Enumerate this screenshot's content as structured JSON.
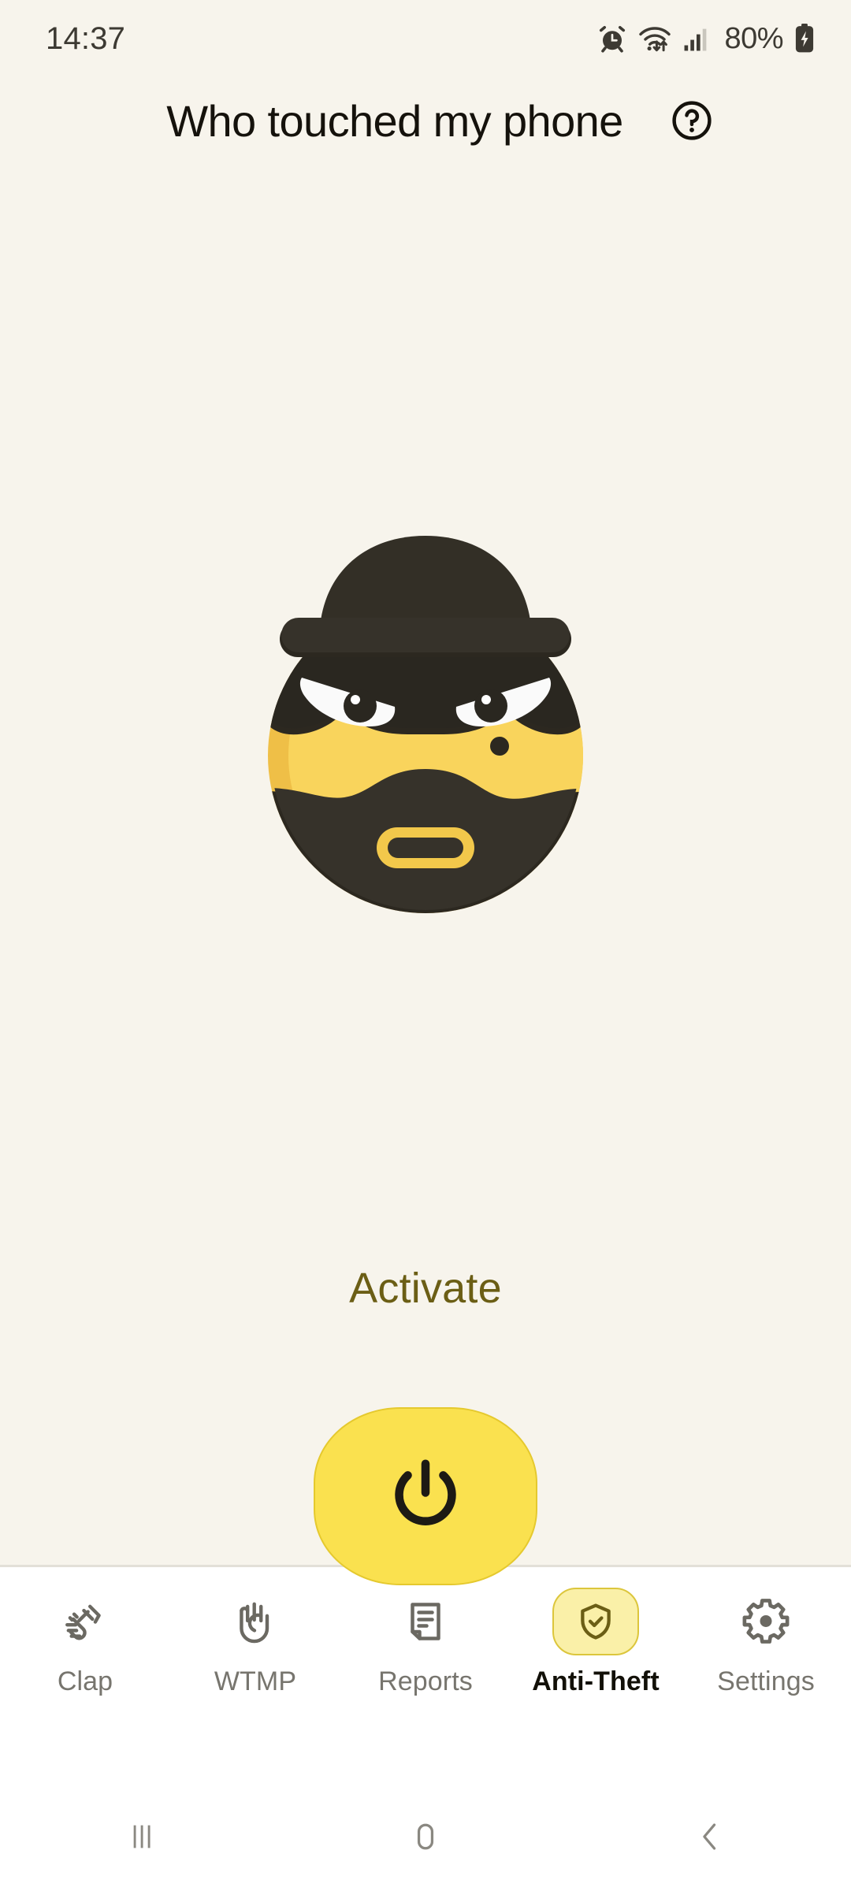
{
  "statusbar": {
    "time": "14:37",
    "battery_text": "80%",
    "icons": [
      "alarm-icon",
      "wifi-icon",
      "signal-icon",
      "battery-charging-icon"
    ]
  },
  "header": {
    "title": "Who touched my phone",
    "help_icon": "help-circle-icon"
  },
  "main": {
    "mascot_icon": "thief-face-illustration",
    "activate_label": "Activate",
    "power_icon": "power-icon"
  },
  "tabs": [
    {
      "label": "Clap",
      "icon": "clapping-hands-icon",
      "active": false
    },
    {
      "label": "WTMP",
      "icon": "raised-hand-icon",
      "active": false
    },
    {
      "label": "Reports",
      "icon": "document-icon",
      "active": false
    },
    {
      "label": "Anti-Theft",
      "icon": "shield-check-icon",
      "active": true
    },
    {
      "label": "Settings",
      "icon": "gear-icon",
      "active": false
    }
  ],
  "navbar": {
    "recents": "recents-icon",
    "home": "home-icon",
    "back": "back-icon"
  },
  "colors": {
    "background": "#F7F4EC",
    "accent_yellow": "#FAE14F",
    "face_yellow": "#F9D45C",
    "dark": "#332F26",
    "olive": "#6B5E15",
    "tab_inactive": "#77756E",
    "tabbar_bg": "#FFFFFF"
  }
}
